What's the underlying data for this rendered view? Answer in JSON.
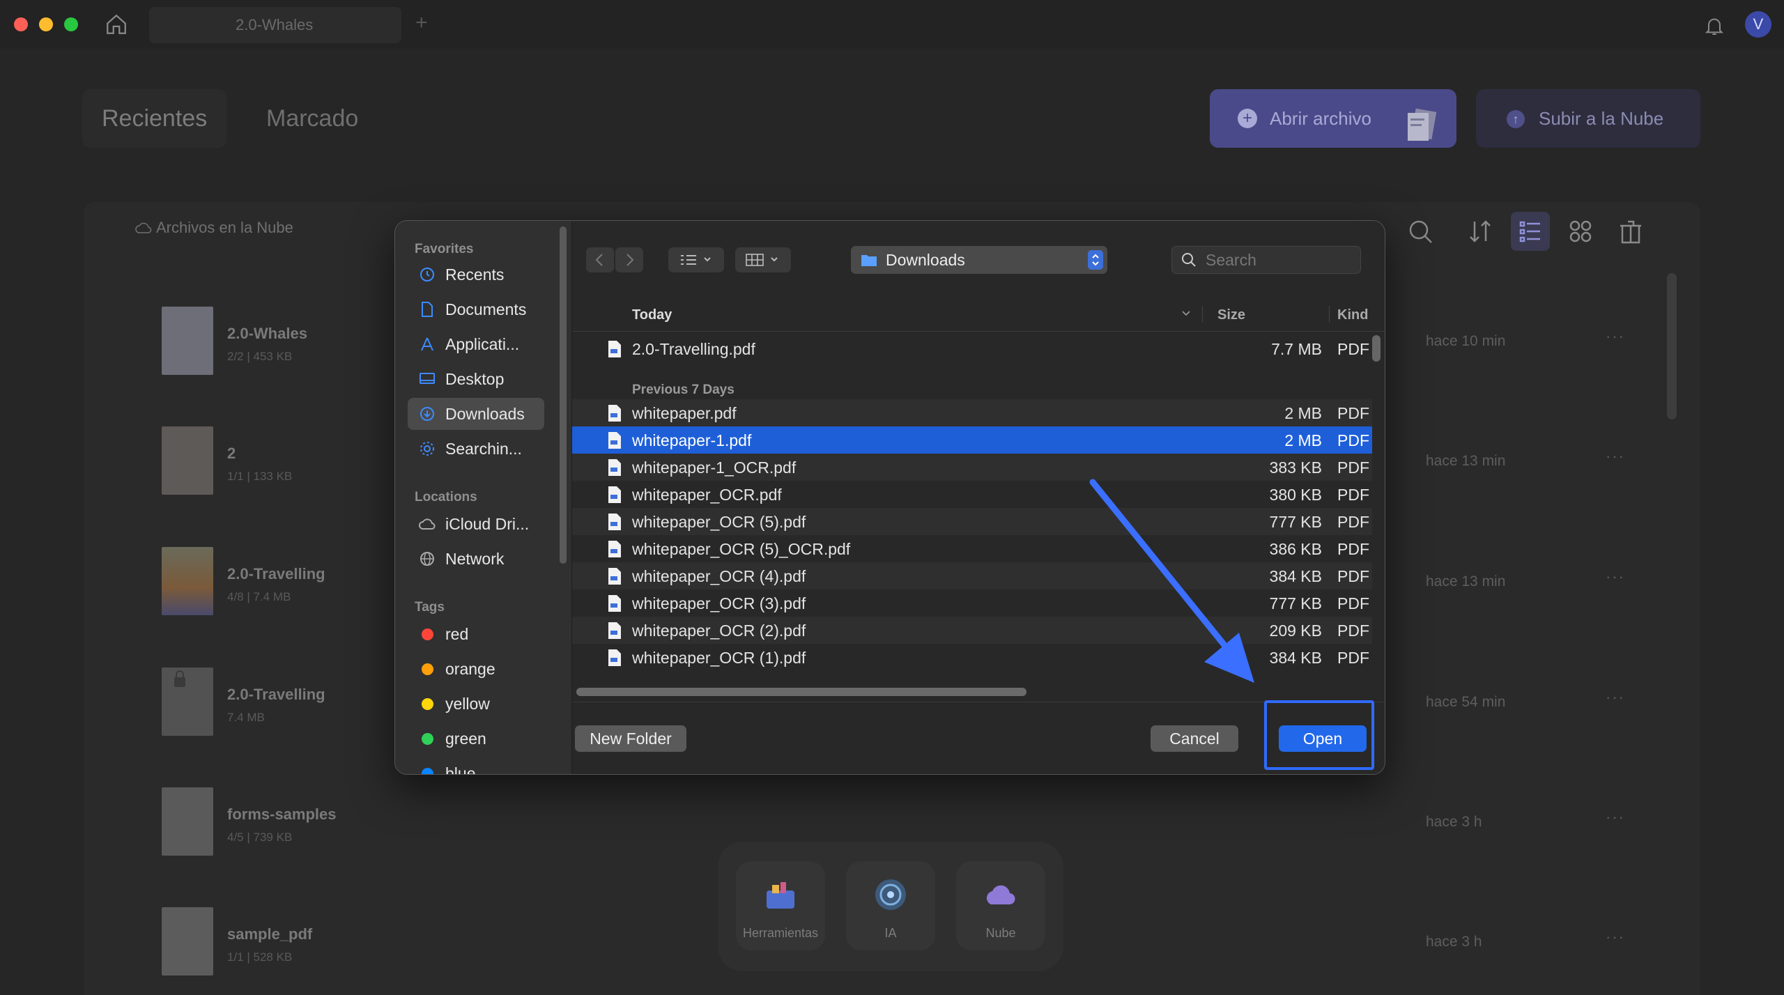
{
  "window": {
    "tab_title": "2.0-Whales",
    "avatar_initial": "V"
  },
  "nav": {
    "recents": "Recientes",
    "marked": "Marcado"
  },
  "actions": {
    "open_file": "Abrir archivo",
    "upload_cloud": "Subir a la Nube"
  },
  "cloud_files_label": "Archivos en la Nube",
  "files": [
    {
      "name": "2.0-Whales",
      "meta": "2/2  |  453 KB",
      "time": "hace 10 min"
    },
    {
      "name": "2",
      "meta": "1/1  |  133 KB",
      "time": "hace 13 min"
    },
    {
      "name": "2.0-Travelling",
      "meta": "4/8  |  7.4 MB",
      "time": "hace 13 min"
    },
    {
      "name": "2.0-Travelling",
      "meta": "7.4 MB",
      "time": "hace 54 min"
    },
    {
      "name": "forms-samples",
      "meta": "4/5  |  739 KB",
      "time": "hace 3 h"
    },
    {
      "name": "sample_pdf",
      "meta": "1/1  |  528 KB",
      "time": "hace 3 h"
    }
  ],
  "more_glyph": "···",
  "dock": {
    "tools": "Herramientas",
    "ai": "IA",
    "cloud": "Nube"
  },
  "dialog": {
    "sidebar": {
      "favorites_header": "Favorites",
      "favorites": [
        "Recents",
        "Documents",
        "Applicati...",
        "Desktop",
        "Downloads",
        "Searchin..."
      ],
      "locations_header": "Locations",
      "locations": [
        "iCloud Dri...",
        "Network"
      ],
      "tags_header": "Tags",
      "tags": [
        {
          "name": "red",
          "color": "#ff453a"
        },
        {
          "name": "orange",
          "color": "#ff9f0a"
        },
        {
          "name": "yellow",
          "color": "#ffd60a"
        },
        {
          "name": "green",
          "color": "#30d158"
        },
        {
          "name": "blue",
          "color": "#0a84ff"
        }
      ]
    },
    "location": "Downloads",
    "search_placeholder": "Search",
    "columns": {
      "name": "Today",
      "size": "Size",
      "kind": "Kind"
    },
    "today_files": [
      {
        "name": "2.0-Travelling.pdf",
        "size": "7.7 MB",
        "kind": "PDF"
      }
    ],
    "previous_label": "Previous 7 Days",
    "previous_files": [
      {
        "name": "whitepaper.pdf",
        "size": "2 MB",
        "kind": "PDF"
      },
      {
        "name": "whitepaper-1.pdf",
        "size": "2 MB",
        "kind": "PDF"
      },
      {
        "name": "whitepaper-1_OCR.pdf",
        "size": "383 KB",
        "kind": "PDF"
      },
      {
        "name": "whitepaper_OCR.pdf",
        "size": "380 KB",
        "kind": "PDF"
      },
      {
        "name": "whitepaper_OCR (5).pdf",
        "size": "777 KB",
        "kind": "PDF"
      },
      {
        "name": "whitepaper_OCR (5)_OCR.pdf",
        "size": "386 KB",
        "kind": "PDF"
      },
      {
        "name": "whitepaper_OCR (4).pdf",
        "size": "384 KB",
        "kind": "PDF"
      },
      {
        "name": "whitepaper_OCR (3).pdf",
        "size": "777 KB",
        "kind": "PDF"
      },
      {
        "name": "whitepaper_OCR (2).pdf",
        "size": "209 KB",
        "kind": "PDF"
      },
      {
        "name": "whitepaper_OCR (1).pdf",
        "size": "384 KB",
        "kind": "PDF"
      }
    ],
    "selected_index": 1,
    "buttons": {
      "new_folder": "New Folder",
      "cancel": "Cancel",
      "open": "Open"
    }
  },
  "colors": {
    "accent": "#2268ea",
    "annotation": "#2f6bff"
  }
}
